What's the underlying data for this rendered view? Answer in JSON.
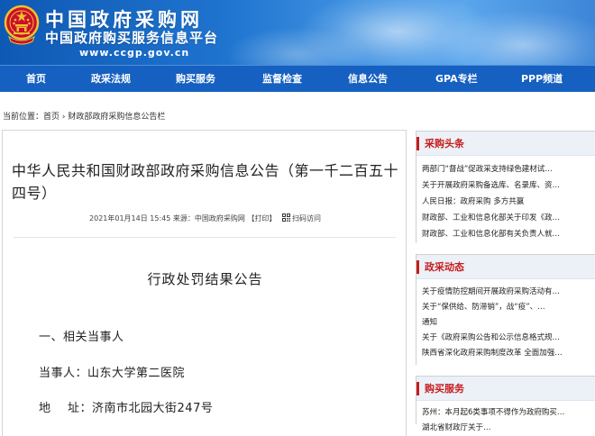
{
  "header": {
    "site_name": "中国政府采购网",
    "site_subname": "中国政府购买服务信息平台",
    "site_url": "www.ccgp.gov.cn"
  },
  "nav": {
    "items": [
      "首页",
      "政采法规",
      "购买服务",
      "监督检查",
      "信息公告",
      "GPA专栏",
      "PPP频道"
    ]
  },
  "breadcrumb": {
    "prefix": "当前位置：",
    "home": "首页",
    "sep": "›",
    "current": "财政部政府采购信息公告栏"
  },
  "article": {
    "title": "中华人民共和国财政部政府采购信息公告（第一千二百五十四号）",
    "meta_date": "2021年01月14日  15:45",
    "meta_source": "来源：中国政府采购网",
    "meta_print": "【打印】",
    "meta_qr": "扫码访问",
    "doc_heading": "行政处罚结果公告",
    "section_1": "一、相关当事人",
    "party_line": "当事人：山东大学第二医院",
    "address_line": "地    址：济南市北园大街247号"
  },
  "sidebar": {
    "boxes": [
      {
        "title": "采购头条",
        "items": [
          "两部门“督战”促政采支持绿色建材试…",
          "关于开展政府采购备选库、名录库、资…",
          "人民日报：政府采购 多方共赢",
          "财政部、工业和信息化部关于印发《政…",
          "财政部、工业和信息化部有关负责人就…"
        ]
      },
      {
        "title": "政采动态",
        "items": [
          "关于疫情防控期间开展政府采购活动有…",
          "关于“保供给、防滞销”，战“疫”、…",
          "通知",
          "关于《政府采购公告和公示信息格式规…",
          "陕西省深化政府采购制度改革 全面加强…"
        ]
      },
      {
        "title": "购买服务",
        "items": [
          "苏州：本月起6类事项不得作为政府购买…",
          "湖北省财政厅关于…"
        ]
      }
    ]
  },
  "colors": {
    "banner_blue": "#1560c1",
    "accent_red": "#c51d1d",
    "sidebar_header_bg": "#ecf1f8"
  }
}
